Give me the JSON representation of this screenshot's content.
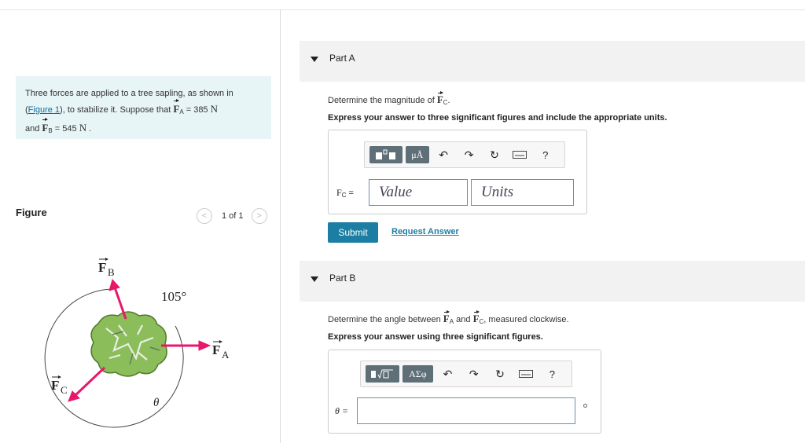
{
  "problem": {
    "text1": "Three forces are applied to a tree sapling, as shown in",
    "figure_link": "Figure 1",
    "text2": ", to stabilize it. Suppose that",
    "fa_symbol": "F",
    "fa_sub": "A",
    "fa_value": "= 385",
    "fa_unit": "N",
    "and": "and",
    "fb_symbol": "F",
    "fb_sub": "B",
    "fb_value": "= 545",
    "fb_unit": "N",
    "end": "."
  },
  "figure_panel": {
    "label": "Figure",
    "counter": "1 of 1",
    "prev": "<",
    "next": ">",
    "angle_label": "105°",
    "theta_label": "θ",
    "fb_label": "F",
    "fb_sub": "B",
    "fa_label": "F",
    "fa_sub": "A",
    "fc_label": "F",
    "fc_sub": "C"
  },
  "part_a": {
    "title": "Part A",
    "question": "Determine the magnitude of",
    "question_sym": "F",
    "question_sub": "C",
    "question_end": ".",
    "instruction": "Express your answer to three significant figures and include the appropriate units.",
    "toolbar": {
      "unit_symbol": "μÅ",
      "help": "?"
    },
    "field_label": "F",
    "field_sub": "C",
    "field_eq": "=",
    "value_placeholder": "Value",
    "units_placeholder": "Units",
    "submit_label": "Submit",
    "request_label": "Request Answer"
  },
  "part_b": {
    "title": "Part B",
    "question_pre": "Determine the angle between",
    "sym1": "F",
    "sub1": "A",
    "and": "and",
    "sym2": "F",
    "sub2": "C",
    "question_post": ", measured clockwise.",
    "instruction": "Express your answer using three significant figures.",
    "toolbar": {
      "symbols": "ΑΣφ",
      "help": "?"
    },
    "field_label": "θ =",
    "value": ""
  },
  "colors": {
    "accent": "#1b7ea2",
    "arrow": "#e8176b",
    "tree": "#8bbd5a",
    "info_bg": "#e8f5f7"
  }
}
